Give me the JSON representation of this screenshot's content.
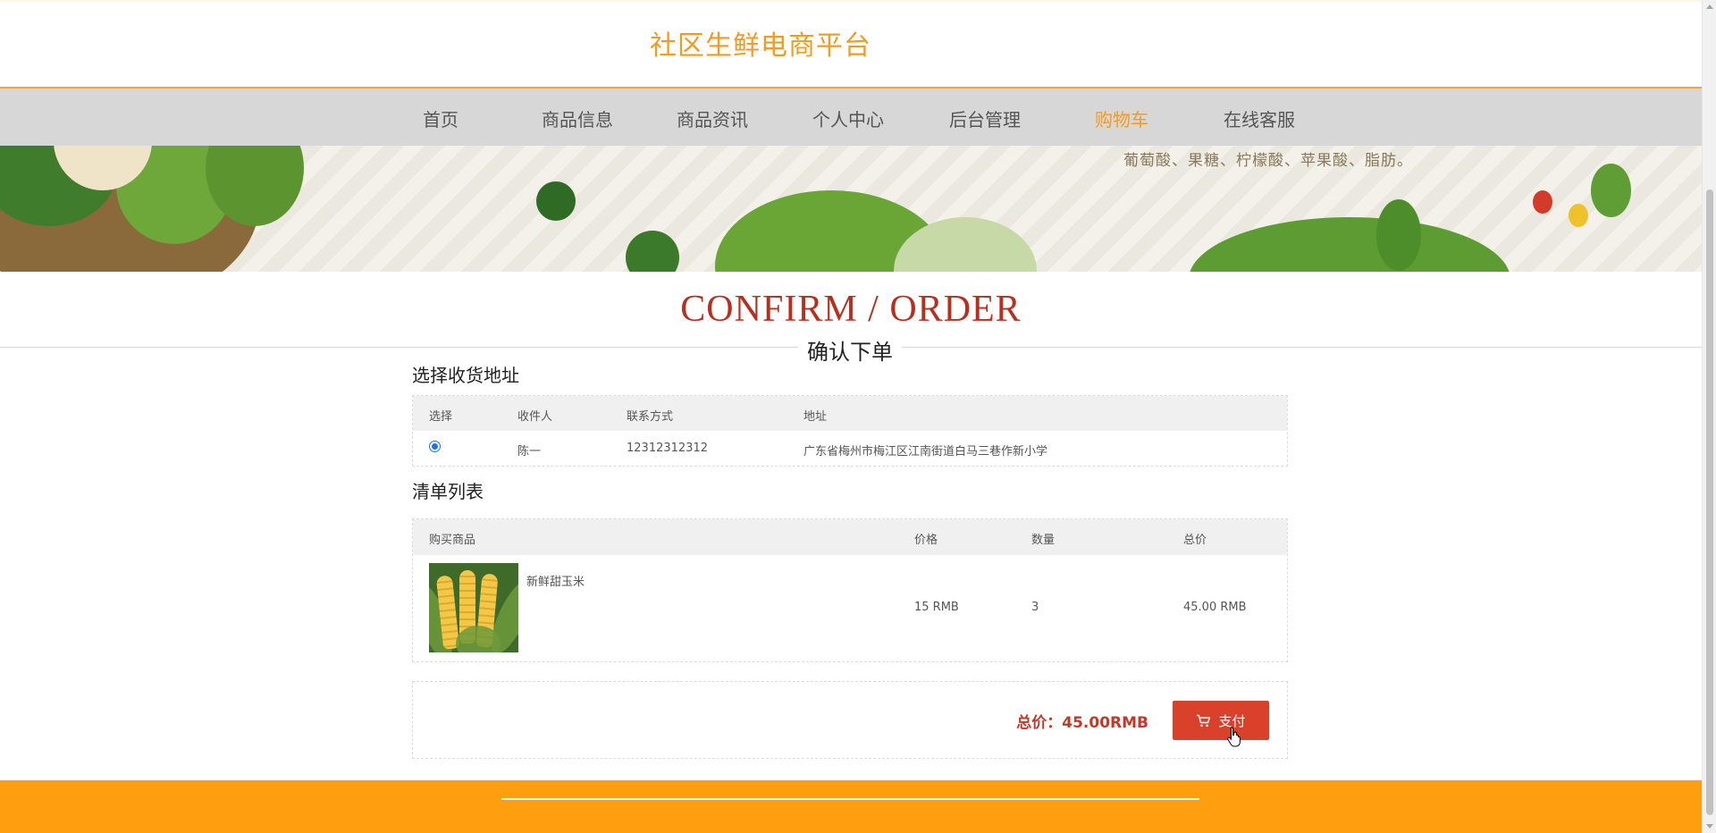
{
  "header": {
    "site_title": "社区生鲜电商平台"
  },
  "nav": {
    "items": [
      {
        "label": "首页"
      },
      {
        "label": "商品信息"
      },
      {
        "label": "商品资讯"
      },
      {
        "label": "个人中心"
      },
      {
        "label": "后台管理"
      },
      {
        "label": "购物车"
      },
      {
        "label": "在线客服"
      }
    ],
    "active_label": "购物车"
  },
  "banner": {
    "text": "葡萄酸、果糖、柠檬酸、苹果酸、脂肪。"
  },
  "page_heading": {
    "english": "CONFIRM / ORDER",
    "chinese": "确认下单"
  },
  "address_section": {
    "title": "选择收货地址",
    "columns": [
      "选择",
      "收件人",
      "联系方式",
      "地址"
    ],
    "rows": [
      {
        "selected": true,
        "recipient": "陈一",
        "phone": "12312312312",
        "address": "广东省梅州市梅江区江南街道白马三巷作新小学"
      }
    ]
  },
  "items_section": {
    "title": "清单列表",
    "columns": [
      "购买商品",
      "价格",
      "数量",
      "总价"
    ],
    "rows": [
      {
        "name": "新鲜甜玉米",
        "price": "15 RMB",
        "quantity": "3",
        "total": "45.00 RMB"
      }
    ]
  },
  "checkout": {
    "total_label": "总价：45.00RMB",
    "pay_label": "支付"
  },
  "colors": {
    "brand_orange": "#f39a1f",
    "accent_red": "#d9412b",
    "footer_orange": "#ff9f0f",
    "heading_red": "#b7301f"
  }
}
